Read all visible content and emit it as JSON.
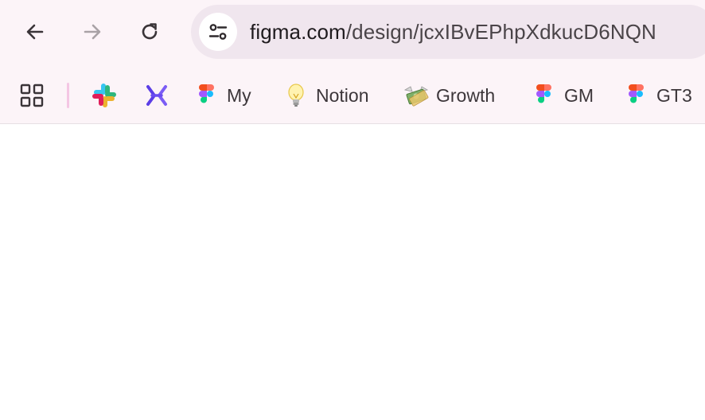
{
  "toolbar": {
    "back_icon": "arrow-left-icon",
    "forward_icon": "arrow-right-icon",
    "reload_icon": "reload-icon"
  },
  "omnibox": {
    "site_info_icon": "tune-icon",
    "url_domain": "figma.com",
    "url_path": "/design/jcxIBvEPhpXdkucD6NQN"
  },
  "bookmarks": {
    "apps_icon": "apps-grid-icon",
    "items": [
      {
        "label": "",
        "icon": "slack-icon"
      },
      {
        "label": "",
        "icon": "x-logo-icon"
      },
      {
        "label": "My",
        "icon": "figma-icon"
      },
      {
        "label": "Notion",
        "icon": "lightbulb-icon"
      },
      {
        "label": "Growth",
        "icon": "money-with-wings-icon"
      },
      {
        "label": "GM",
        "icon": "figma-icon"
      },
      {
        "label": "GT3",
        "icon": "figma-icon"
      }
    ]
  },
  "colors": {
    "chrome_bg": "#fcf4f8",
    "omnibox_bg": "#f0e6ee",
    "divider": "#f4c6e4",
    "text": "#3c363a"
  }
}
